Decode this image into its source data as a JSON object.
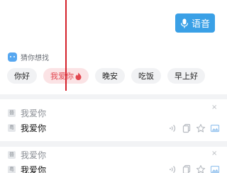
{
  "voice_button": {
    "label": "语音",
    "icon": "microphone-icon",
    "color": "#3aa0e6"
  },
  "guess": {
    "title": "猜你想找",
    "chips": [
      {
        "label": "你好"
      },
      {
        "label": "我爱你",
        "active": true,
        "badge_icon": "fire-icon"
      },
      {
        "label": "晚安"
      },
      {
        "label": "吃饭"
      },
      {
        "label": "早上好"
      }
    ]
  },
  "history": [
    {
      "source_tag": "普",
      "source_text": "我爱你",
      "target_tag": "粤",
      "target_text": "我爱你",
      "close_label": "×"
    },
    {
      "source_tag": "普",
      "source_text": "我爱你",
      "target_tag": "粤",
      "target_text": "我爱你",
      "close_label": "×"
    }
  ],
  "colors": {
    "accent": "#3aa0e6",
    "active_chip_bg": "#fbe3e5",
    "active_chip_text": "#e2464f",
    "indicator_line": "#d4202a"
  }
}
